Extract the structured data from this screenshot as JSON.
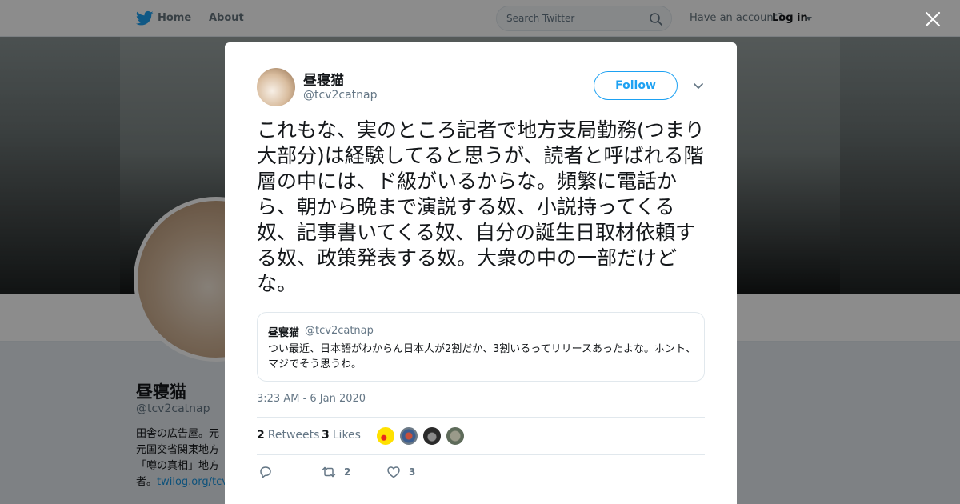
{
  "topbar": {
    "home_label": "Home",
    "about_label": "About",
    "search_placeholder": "Search Twitter",
    "account_prompt": "Have an account?",
    "login_label": "Log in"
  },
  "profile": {
    "name": "昼寝猫",
    "handle": "@tcv2catnap",
    "bio_lines": [
      "田舎の広告屋。元",
      "元国交省関東地方",
      "「噂の真相」地方",
      "者。"
    ],
    "bio_link": "twilog.org/tcv"
  },
  "tweet": {
    "author_name": "昼寝猫",
    "author_handle": "@tcv2catnap",
    "follow_label": "Follow",
    "text": "これもな、実のところ記者で地方支局勤務(つまり大部分)は経験してると思うが、読者と呼ばれる階層の中には、ド級がいるからな。頻繁に電話から、朝から晩まで演説する奴、小説持ってくる奴、記事書いてくる奴、自分の誕生日取材依頼する奴、政策発表する奴。大衆の中の一部だけどな。",
    "timestamp": "3:23 AM - 6 Jan 2020",
    "retweets_count": "2",
    "retweets_label": "Retweets",
    "likes_count": "3",
    "likes_label": "Likes",
    "reply_count": "",
    "action_retweet_count": "2",
    "action_like_count": "3"
  },
  "quoted": {
    "name": "昼寝猫",
    "handle": "@tcv2catnap",
    "text": "つい最近、日本語がわからん日本人が2割だか、3割いるってリリースあったよな。ホント、マジでそう思うわ。"
  },
  "colors": {
    "accent": "#1da1f2",
    "text": "#14171a",
    "secondary": "#657786"
  },
  "icons": [
    "twitter-bird-icon",
    "search-icon",
    "close-icon",
    "chevron-down-icon",
    "reply-icon",
    "retweet-icon",
    "like-icon"
  ]
}
